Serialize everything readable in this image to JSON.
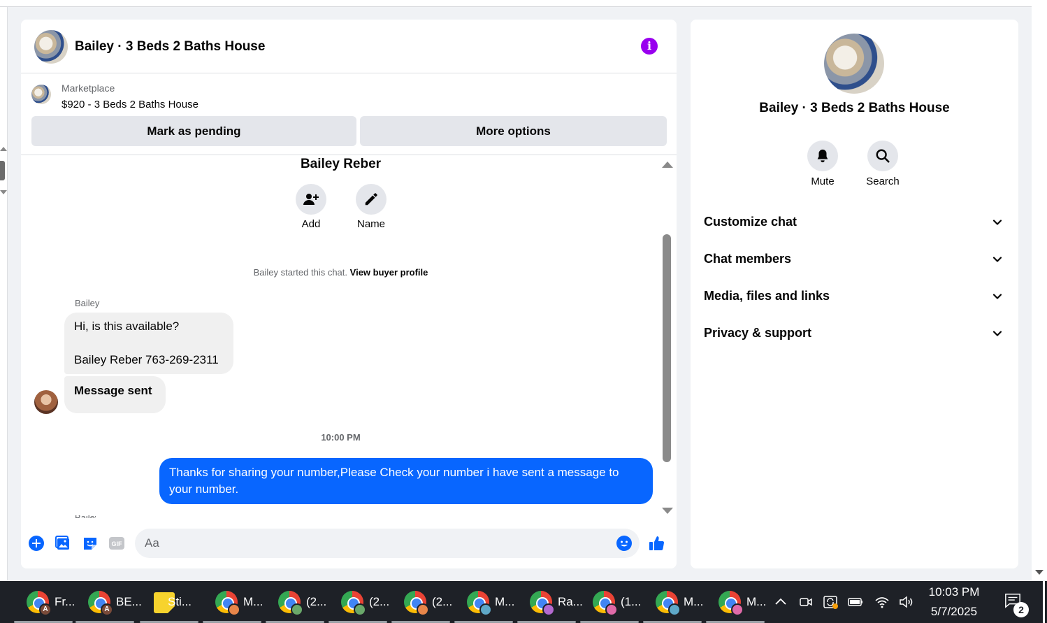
{
  "chat": {
    "title": "Bailey · 3 Beds 2 Baths House",
    "info_icon": "info-icon",
    "listing": {
      "source": "Marketplace",
      "price_title": "$920 - 3 Beds 2 Baths House",
      "mark_pending": "Mark as pending",
      "more_options": "More options"
    },
    "contact_name": "Bailey Reber",
    "actions": [
      {
        "label": "Add",
        "icon": "add-person-icon"
      },
      {
        "label": "Name",
        "icon": "pencil-icon"
      }
    ],
    "system_text": "Bailey started this chat.",
    "system_link": "View buyer profile",
    "sender": "Bailey",
    "incoming": {
      "line1": "Hi, is this available?",
      "line2": "Bailey Reber 763-269-2311",
      "sent_notice": "Message sent"
    },
    "timestamp": "10:00 PM",
    "outgoing": "Thanks for sharing your number,Please Check your number i have sent a message to your number.",
    "composer": {
      "placeholder": "Aa",
      "icons": [
        "plus-icon",
        "photo-icon",
        "sticker-icon",
        "gif-icon",
        "emoji-icon",
        "like-icon"
      ],
      "gif_label": "GIF"
    }
  },
  "info": {
    "title": "Bailey · 3 Beds 2 Baths House",
    "actions": [
      {
        "label": "Mute",
        "icon": "bell-icon"
      },
      {
        "label": "Search",
        "icon": "search-icon"
      }
    ],
    "sections": [
      "Customize chat",
      "Chat members",
      "Media, files and links",
      "Privacy & support"
    ]
  },
  "taskbar": {
    "items": [
      {
        "label": "Fr...",
        "badge": "A",
        "badge_color": "#7a4b3a"
      },
      {
        "label": "BE...",
        "badge": "A",
        "badge_color": "#7a4b3a"
      },
      {
        "label": "Sti...",
        "app": "sticky-notes"
      },
      {
        "label": "M...",
        "badge_color": "#e8864a"
      },
      {
        "label": "(2...",
        "badge_color": "#6aa86a"
      },
      {
        "label": "(2...",
        "badge_color": "#6aa86a"
      },
      {
        "label": "(2...",
        "badge_color": "#e8864a"
      },
      {
        "label": "M...",
        "badge_color": "#5fa8c8"
      },
      {
        "label": "Ra...",
        "badge_color": "#b46ad0"
      },
      {
        "label": "(1...",
        "badge_color": "#e06aa8"
      },
      {
        "label": "M...",
        "badge_color": "#5fa8c8"
      },
      {
        "label": "M...",
        "badge_color": "#e06aa8"
      }
    ],
    "tray": {
      "time": "10:03 PM",
      "date": "5/7/2025",
      "notifications": "2"
    }
  },
  "colors": {
    "accent": "#0866ff",
    "info_purple": "#9900ef",
    "taskbar": "#1e2127"
  }
}
